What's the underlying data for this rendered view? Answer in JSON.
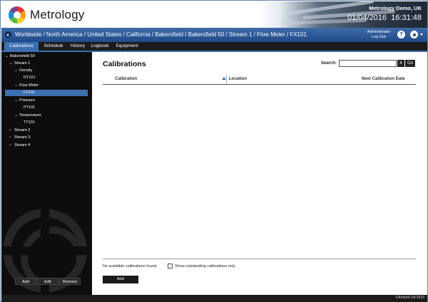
{
  "header": {
    "app_title": "Metrology",
    "site": "Metrology Demo, UK",
    "date": "01/04/2016",
    "time": "16:31:48"
  },
  "breadcrumb": "Worldwide / North America / United States / California / Bakersfield / Bakersfield 50 / Stream 1 / Flow Meter / FX101",
  "user": {
    "name": "Administrator",
    "logout": "Log Out"
  },
  "icons": [
    "back-icon",
    "help-icon",
    "settings-icon",
    "chevron-down-icon",
    "sort-asc-icon",
    "close-icon"
  ],
  "tabs": [
    {
      "label": "Calibrations",
      "active": true
    },
    {
      "label": "Schedule"
    },
    {
      "label": "History"
    },
    {
      "label": "Logbook"
    },
    {
      "label": "Equipment"
    }
  ],
  "tree": [
    {
      "label": "Bakersfield 50",
      "expanded": true
    },
    {
      "label": "Stream 1",
      "expanded": true
    },
    {
      "label": "Density",
      "expanded": true
    },
    {
      "label": "DT101"
    },
    {
      "label": "Flow Meter",
      "expanded": true
    },
    {
      "label": "FX101",
      "selected": true
    },
    {
      "label": "Pressure",
      "expanded": true
    },
    {
      "label": "PT101"
    },
    {
      "label": "Temperature",
      "expanded": true
    },
    {
      "label": "TT101"
    },
    {
      "label": "Stream 2",
      "expanded": false
    },
    {
      "label": "Stream 3",
      "expanded": false
    },
    {
      "label": "Stream 4",
      "expanded": false
    }
  ],
  "sidebar_buttons": {
    "add": "Add",
    "edit": "Edit",
    "remove": "Remove"
  },
  "main": {
    "title": "Calibrations",
    "search_label": "Search:",
    "search_value": "",
    "clear_label": "x",
    "go_label": "Go",
    "columns": [
      "Calibration",
      "Location",
      "Next Calibration Date"
    ],
    "empty_message": "No available calibrations found.",
    "show_outstanding_label": "Show outstanding calibrations only",
    "show_outstanding_checked": false,
    "add_label": "Add"
  },
  "footer": {
    "copyright": "©Ambird Ltd 2016"
  },
  "colors": {
    "accent": "#3c6eb0",
    "topbar": "#1f4a8a",
    "sidebar": "#0d0d0d"
  }
}
